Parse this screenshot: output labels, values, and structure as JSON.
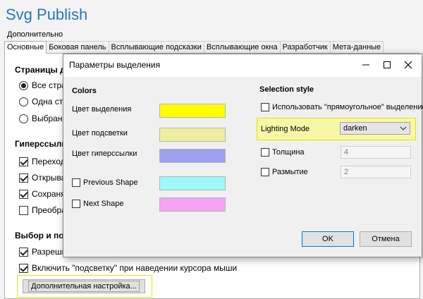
{
  "app": {
    "title": "Svg Publish",
    "more_tab": "Дополнительно",
    "tabs": [
      "Основные",
      "Боковая панель",
      "Всплывающие подсказки",
      "Всплывающие окна",
      "Разработчик",
      "Мета-данные"
    ]
  },
  "main": {
    "pages_section": "Страницы д",
    "radios": [
      {
        "label": "Все стран",
        "checked": true
      },
      {
        "label": "Одна стр",
        "checked": false
      },
      {
        "label": "Выбранн",
        "checked": false
      }
    ],
    "links_section": "Гиперссылки",
    "link_checks": [
      {
        "label": "Переходи",
        "checked": true
      },
      {
        "label": "Открыват",
        "checked": true
      },
      {
        "label": "Сохранят",
        "checked": true
      },
      {
        "label": "Преобраз",
        "checked": false
      }
    ],
    "select_section": "Выбор и под",
    "select_checks": [
      {
        "label": "Разреши",
        "checked": true
      },
      {
        "label": "Включить \"подсветку\" при наведении курсора мыши",
        "checked": true
      }
    ],
    "advanced_button": "Дополнительная настройка..."
  },
  "dialog": {
    "title": "Параметры выделения",
    "colors_header": "Colors",
    "selection_color_label": "Цвет выделения",
    "highlight_color_label": "Цвет подсветки",
    "hyperlink_color_label": "Цвет гиперссылки",
    "previous_shape_label": "Previous Shape",
    "next_shape_label": "Next Shape",
    "selection_style_header": "Selection style",
    "rect_selection_label": "Использовать \"прямоугольное\" выделение",
    "lighting_mode_label": "Lighting Mode",
    "lighting_mode_value": "darken",
    "thickness_label": "Толщина",
    "thickness_value": "4",
    "blur_label": "Размытие",
    "blur_value": "2",
    "ok_label": "OK",
    "cancel_label": "Отмена",
    "colors": {
      "selection": "#ffff00",
      "highlight": "#eeeea0",
      "hyperlink": "#9f9ff0",
      "previous_shape": "#9ff8f8",
      "next_shape": "#f5a4f5"
    }
  },
  "theme": {
    "title_blue": "#2b73c2",
    "highlight_yellow": "#f7f7a8"
  }
}
